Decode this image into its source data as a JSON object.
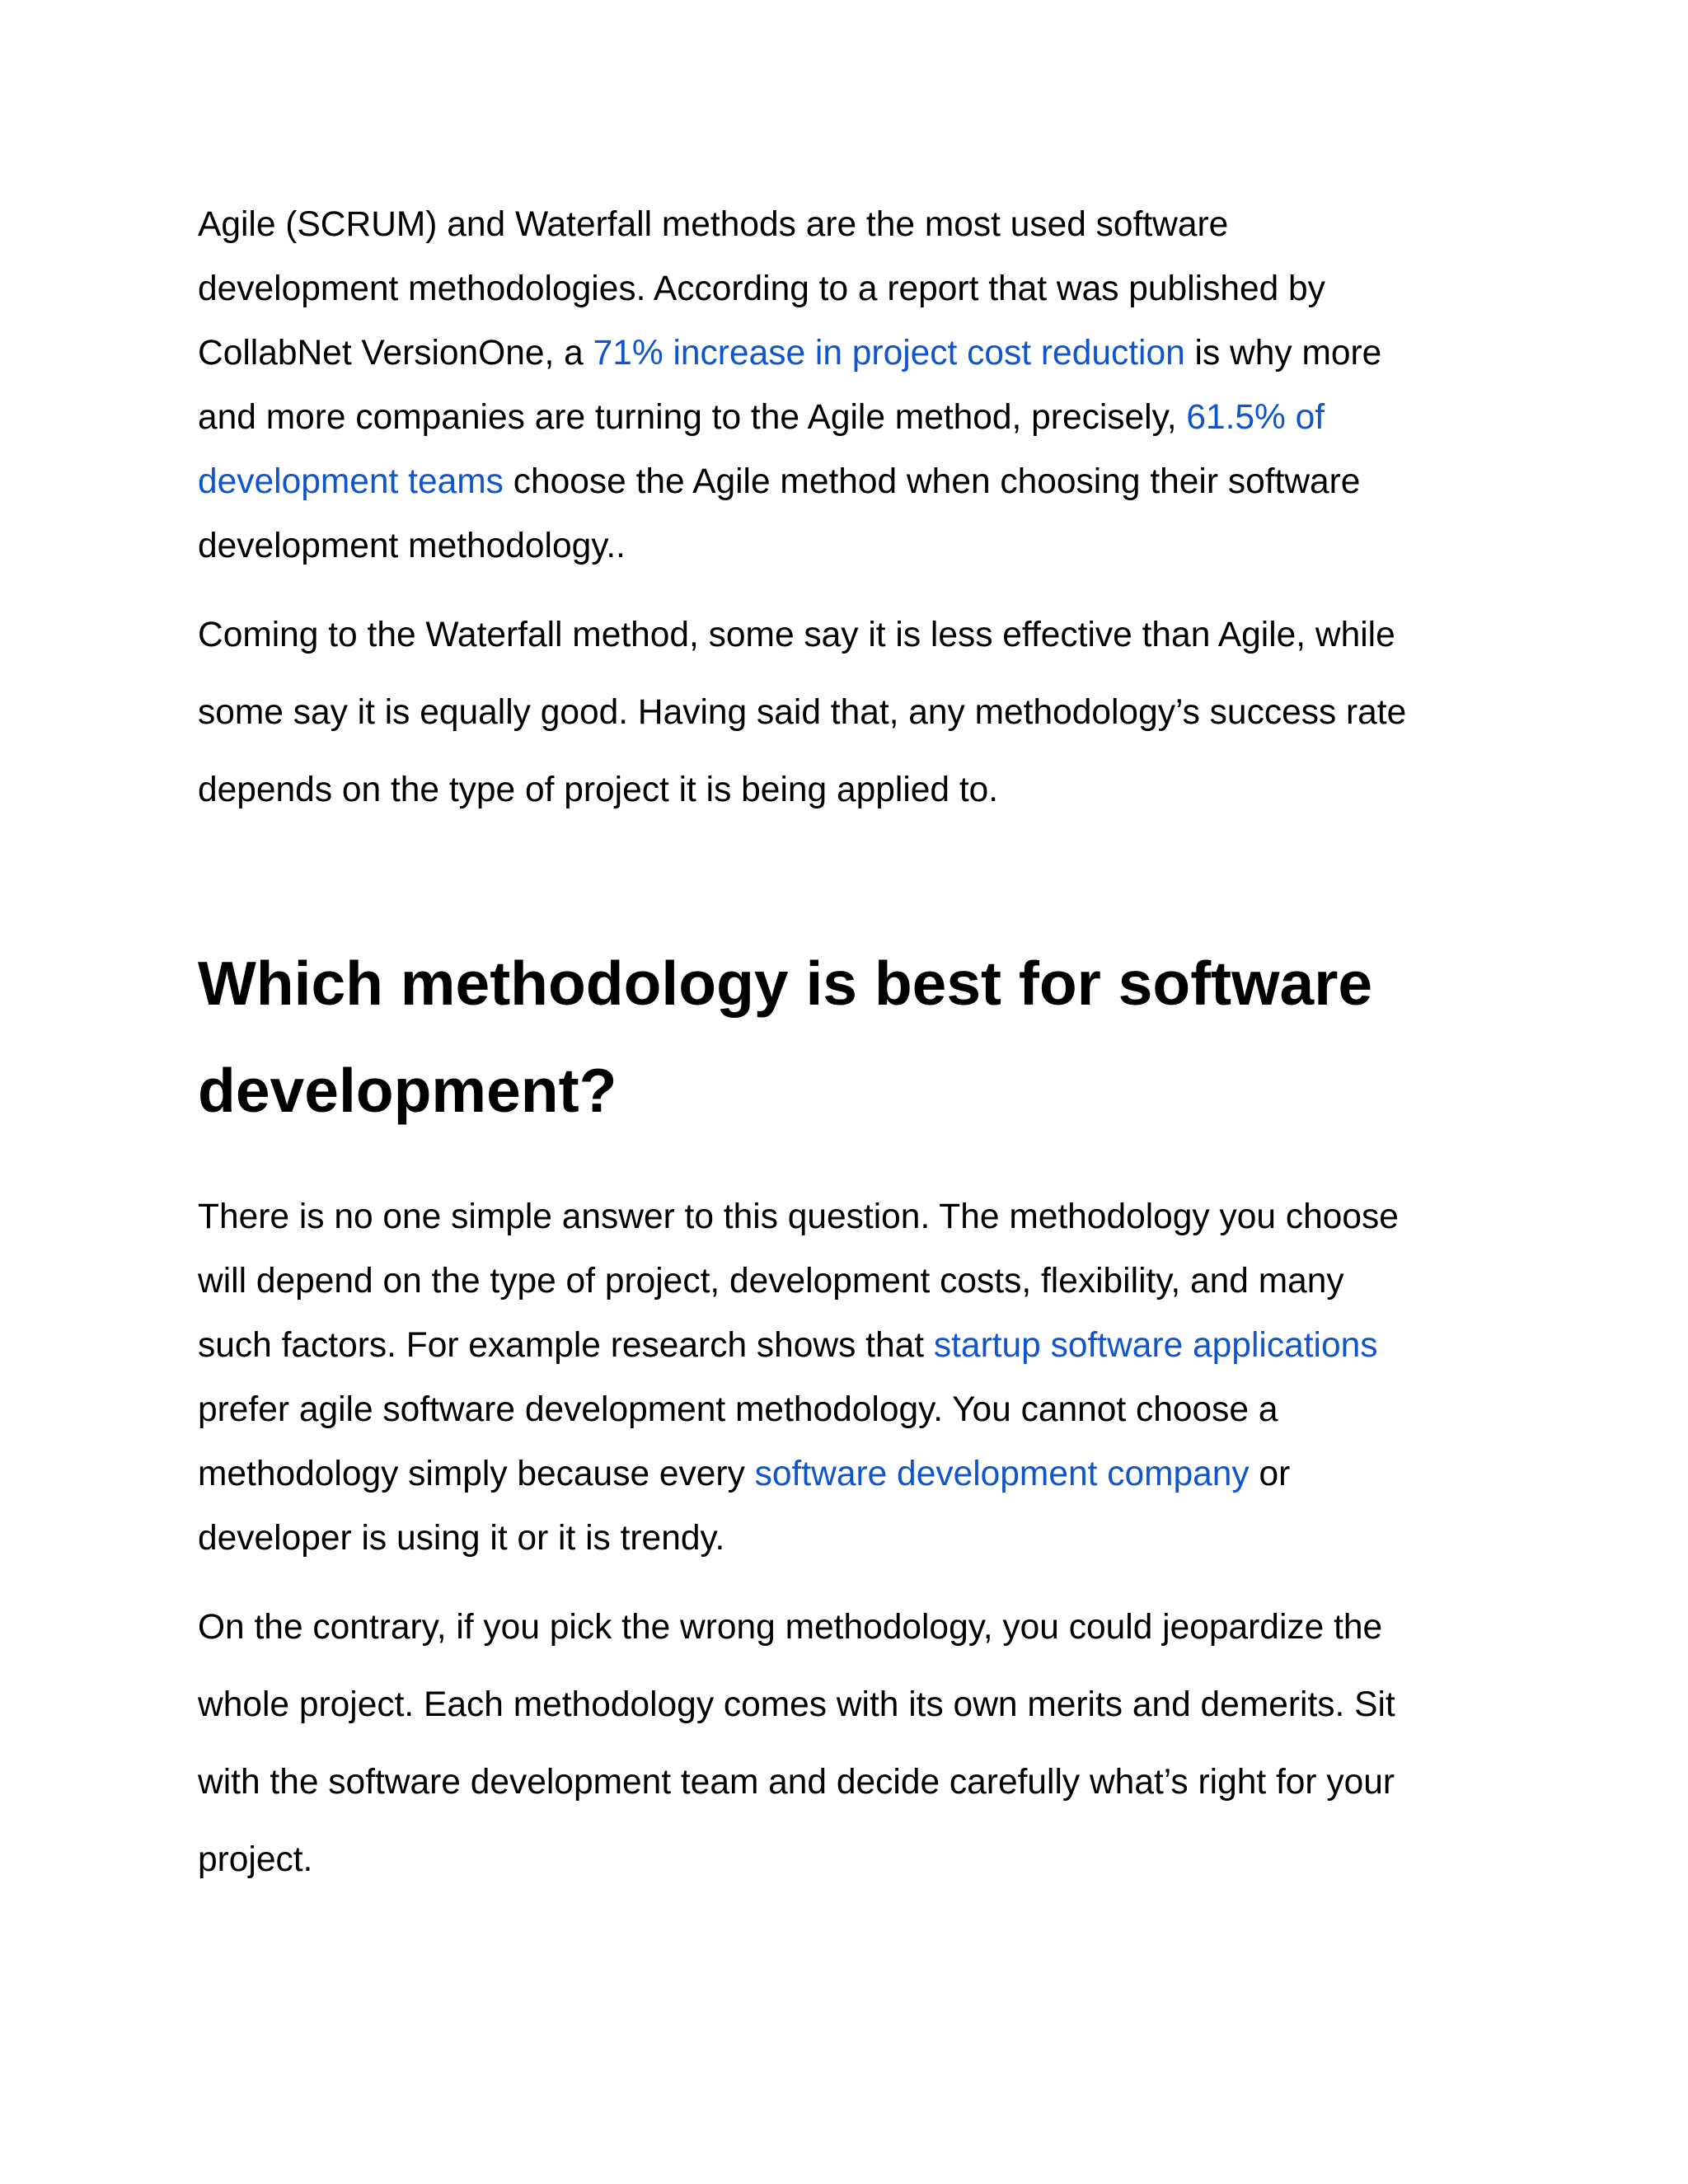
{
  "paragraph1": {
    "l1": "Agile (SCRUM) and Waterfall methods are the most used software",
    "l2": "development methodologies. According to a report that was published by",
    "l3a": "CollabNet VersionOne, a ",
    "link1": "71% increase in project cost reduction",
    "l3b": " is why more",
    "l4a": "and more companies are turning to the Agile method, precisely, ",
    "link2a": "61.5% of",
    "link2b": "development teams",
    "l5b": " choose the Agile method when choosing their software",
    "l6": "development methodology.."
  },
  "paragraph2": {
    "l1": "Coming to the Waterfall method, some say it is less effective than Agile, while",
    "l2": "some say it is equally good. Having said that, any methodology’s success rate",
    "l3": "depends on the type of project it is being applied to."
  },
  "heading": {
    "l1": "Which methodology is best for software",
    "l2": "development?"
  },
  "paragraph3": {
    "l1": "There is no one simple answer to this question. The methodology you choose",
    "l2": "will depend on the type of project, development costs, flexibility, and many",
    "l3a": "such factors. For example research shows that ",
    "link1": "startup software applications",
    "l4": "prefer agile software development methodology. You cannot choose a",
    "l5a": "methodology simply because every ",
    "link2": "software development company",
    "l5b": " or",
    "l6": "developer is using it or it is trendy."
  },
  "paragraph4": {
    "l1": "On the contrary, if you pick the wrong methodology, you could jeopardize the",
    "l2": "whole project. Each methodology comes with its own merits and demerits. Sit",
    "l3": "with the software development team and decide carefully what’s right for your",
    "l4": "project."
  },
  "colors": {
    "text": "#000000",
    "link": "#1155cc",
    "background": "#ffffff"
  }
}
